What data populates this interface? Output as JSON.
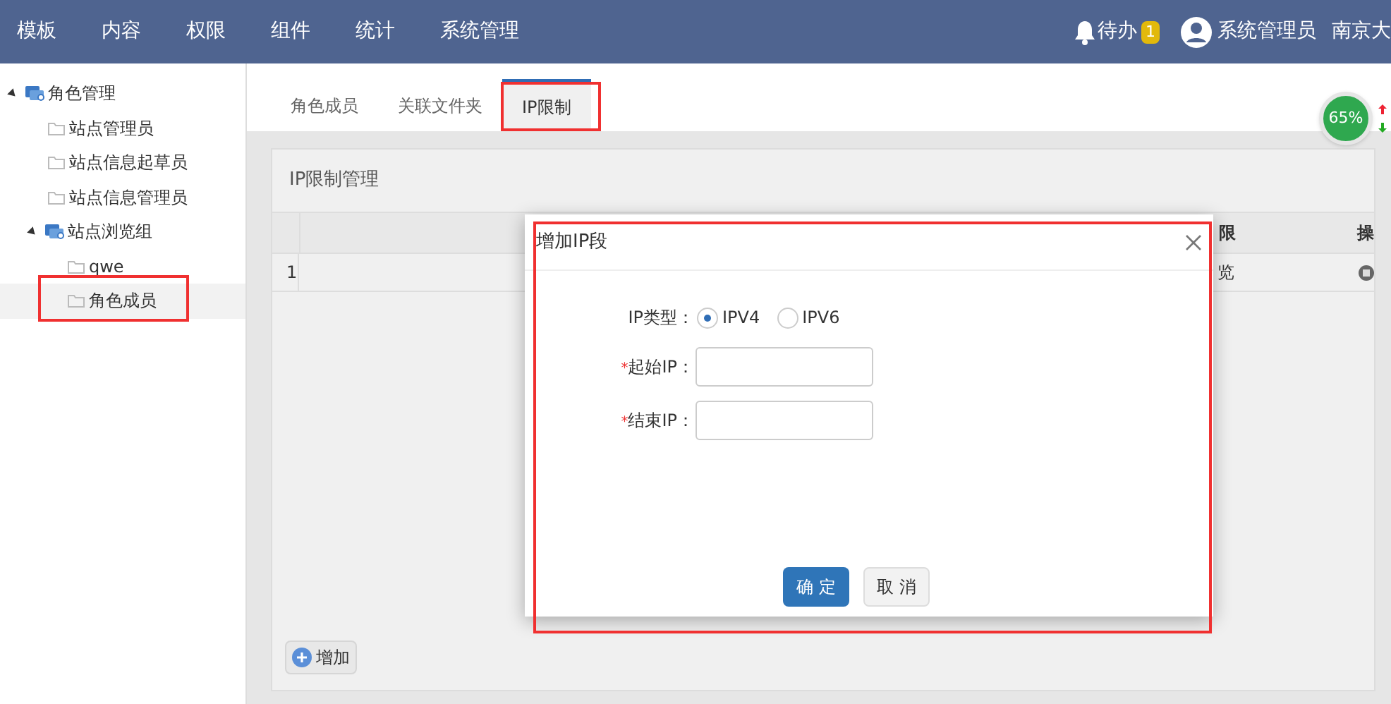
{
  "topbar": {
    "menu": [
      "模板",
      "内容",
      "权限",
      "组件",
      "统计",
      "系统管理"
    ],
    "todo": {
      "label": "待办",
      "count": "1"
    },
    "user": "系统管理员",
    "org": "南京大"
  },
  "sidebar": {
    "tree": [
      {
        "label": "角色管理",
        "kind": "group",
        "expanded": true,
        "selected": false,
        "children": [
          {
            "label": "站点管理员",
            "kind": "leaf",
            "selected": false
          },
          {
            "label": "站点信息起草员",
            "kind": "leaf",
            "selected": false
          },
          {
            "label": "站点信息管理员",
            "kind": "leaf",
            "selected": false
          },
          {
            "label": "站点浏览组",
            "kind": "group",
            "expanded": true,
            "selected": false,
            "children": [
              {
                "label": "qwe",
                "kind": "leaf",
                "selected": false
              },
              {
                "label": "角色成员",
                "kind": "leaf",
                "selected": true
              }
            ]
          }
        ]
      }
    ]
  },
  "tabs": [
    {
      "label": "角色成员",
      "selected": false
    },
    {
      "label": "关联文件夹",
      "selected": false
    },
    {
      "label": "IP限制",
      "selected": true
    }
  ],
  "progress_widget": {
    "reading": "65%"
  },
  "panel": {
    "title": "IP限制管理",
    "table": {
      "columns": [
        "限",
        "操"
      ],
      "rows": [
        {
          "index": "1",
          "cells": [
            "览"
          ]
        }
      ]
    },
    "add_button": "增加"
  },
  "dialog": {
    "title": "增加IP段",
    "ip_type": {
      "label": "IP类型：",
      "options": [
        {
          "label": "IPV4",
          "selected": true
        },
        {
          "label": "IPV6",
          "selected": false
        }
      ]
    },
    "fields": [
      {
        "label": "起始IP：",
        "required_mark": "*"
      },
      {
        "label": "结束IP：",
        "required_mark": "*"
      }
    ],
    "buttons": [
      {
        "label": "确 定",
        "kind": "primary"
      },
      {
        "label": "取 消",
        "kind": "default"
      }
    ]
  }
}
